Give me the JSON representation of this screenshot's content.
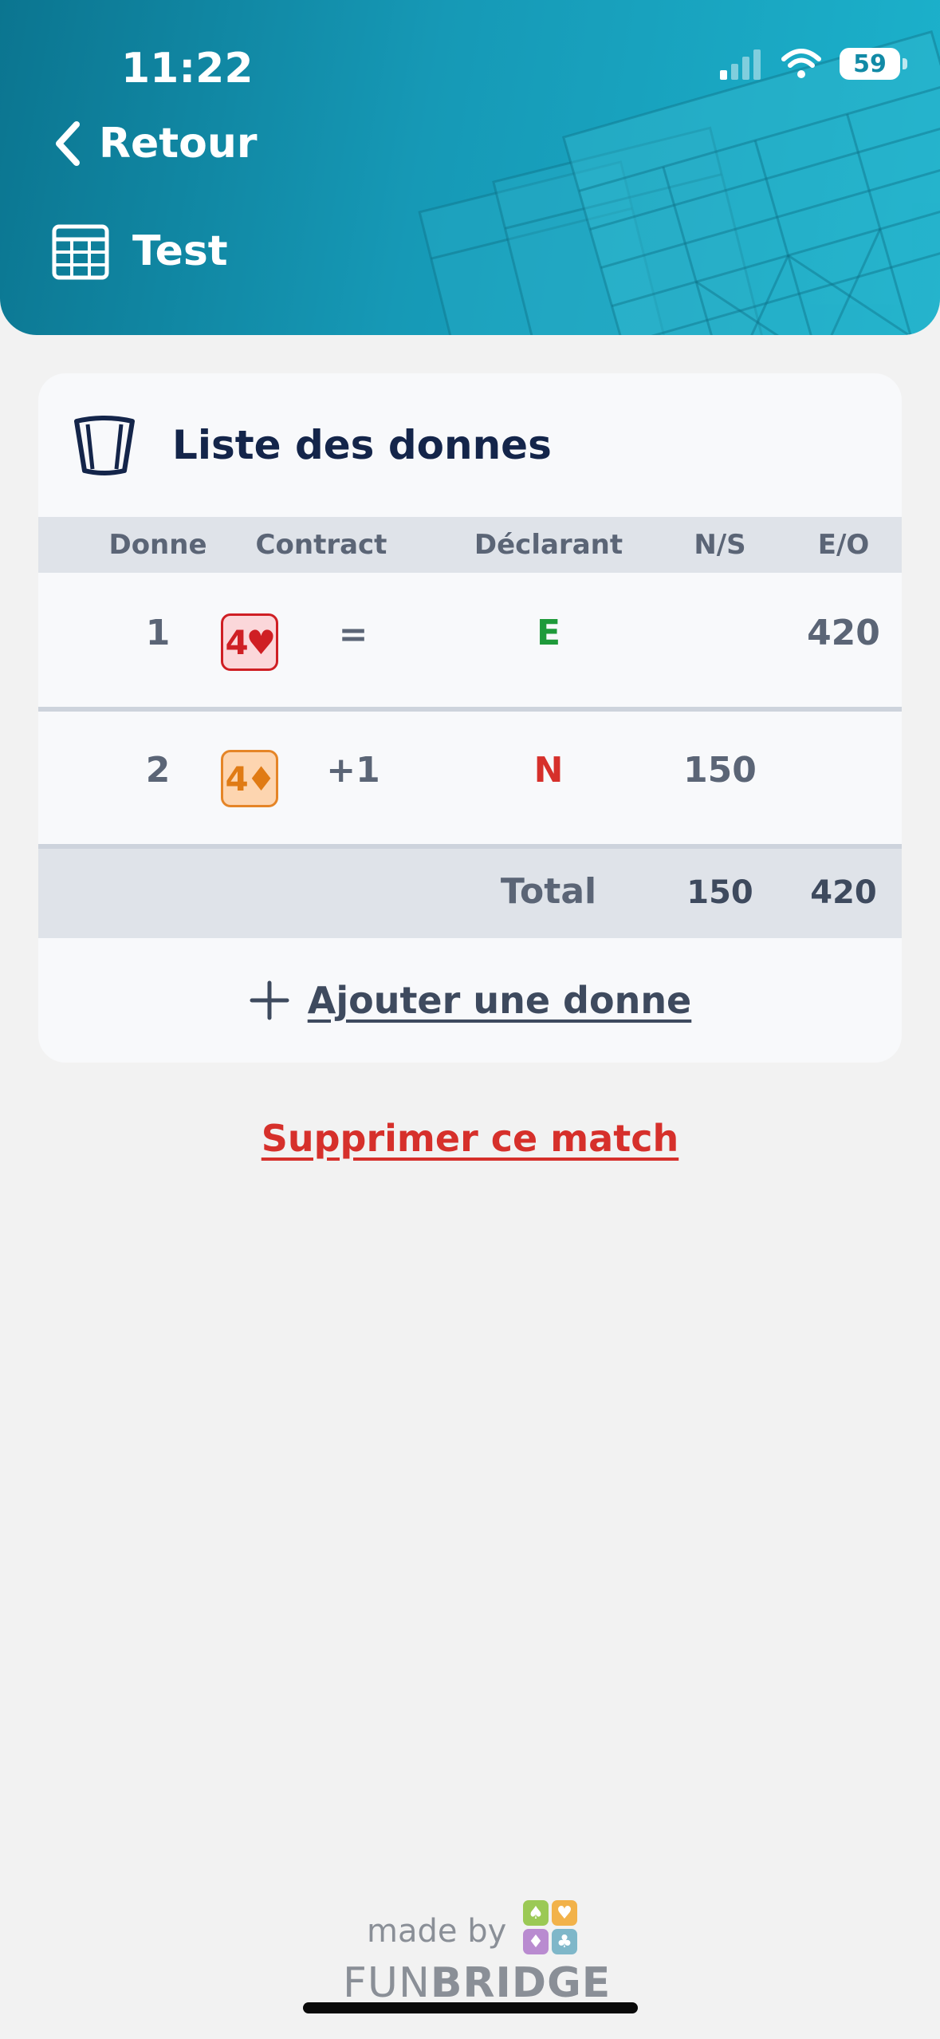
{
  "status_bar": {
    "time": "11:22",
    "battery": "59"
  },
  "header": {
    "back_label": "Retour",
    "title": "Test"
  },
  "card": {
    "title": "Liste des donnes",
    "columns": [
      "Donne",
      "Contract",
      "Déclarant",
      "N/S",
      "E/O"
    ],
    "rows": [
      {
        "donne": "1",
        "contract_level": "4",
        "contract_suit": "♥",
        "result": "=",
        "declarant": "E",
        "ns": "",
        "eo": "420"
      },
      {
        "donne": "2",
        "contract_level": "4",
        "contract_suit": "♦",
        "result": "+1",
        "declarant": "N",
        "ns": "150",
        "eo": ""
      }
    ],
    "total": {
      "label": "Total",
      "ns": "150",
      "eo": "420"
    },
    "add_label": "Ajouter une donne"
  },
  "delete_label": "Supprimer ce match",
  "footer": {
    "made_by": "made by",
    "brand_light": "FUN",
    "brand_bold": "BRIDGE"
  },
  "colors": {
    "header_start": "#0b7590",
    "header_end": "#1cb2cc",
    "declarant_e": "#1e9a3a",
    "declarant_n": "#d6302b",
    "delete": "#d6302b"
  },
  "icons": [
    "chevron-left-icon",
    "calendar-grid-icon",
    "cards-icon",
    "plus-icon",
    "signal-icon",
    "wifi-icon"
  ]
}
